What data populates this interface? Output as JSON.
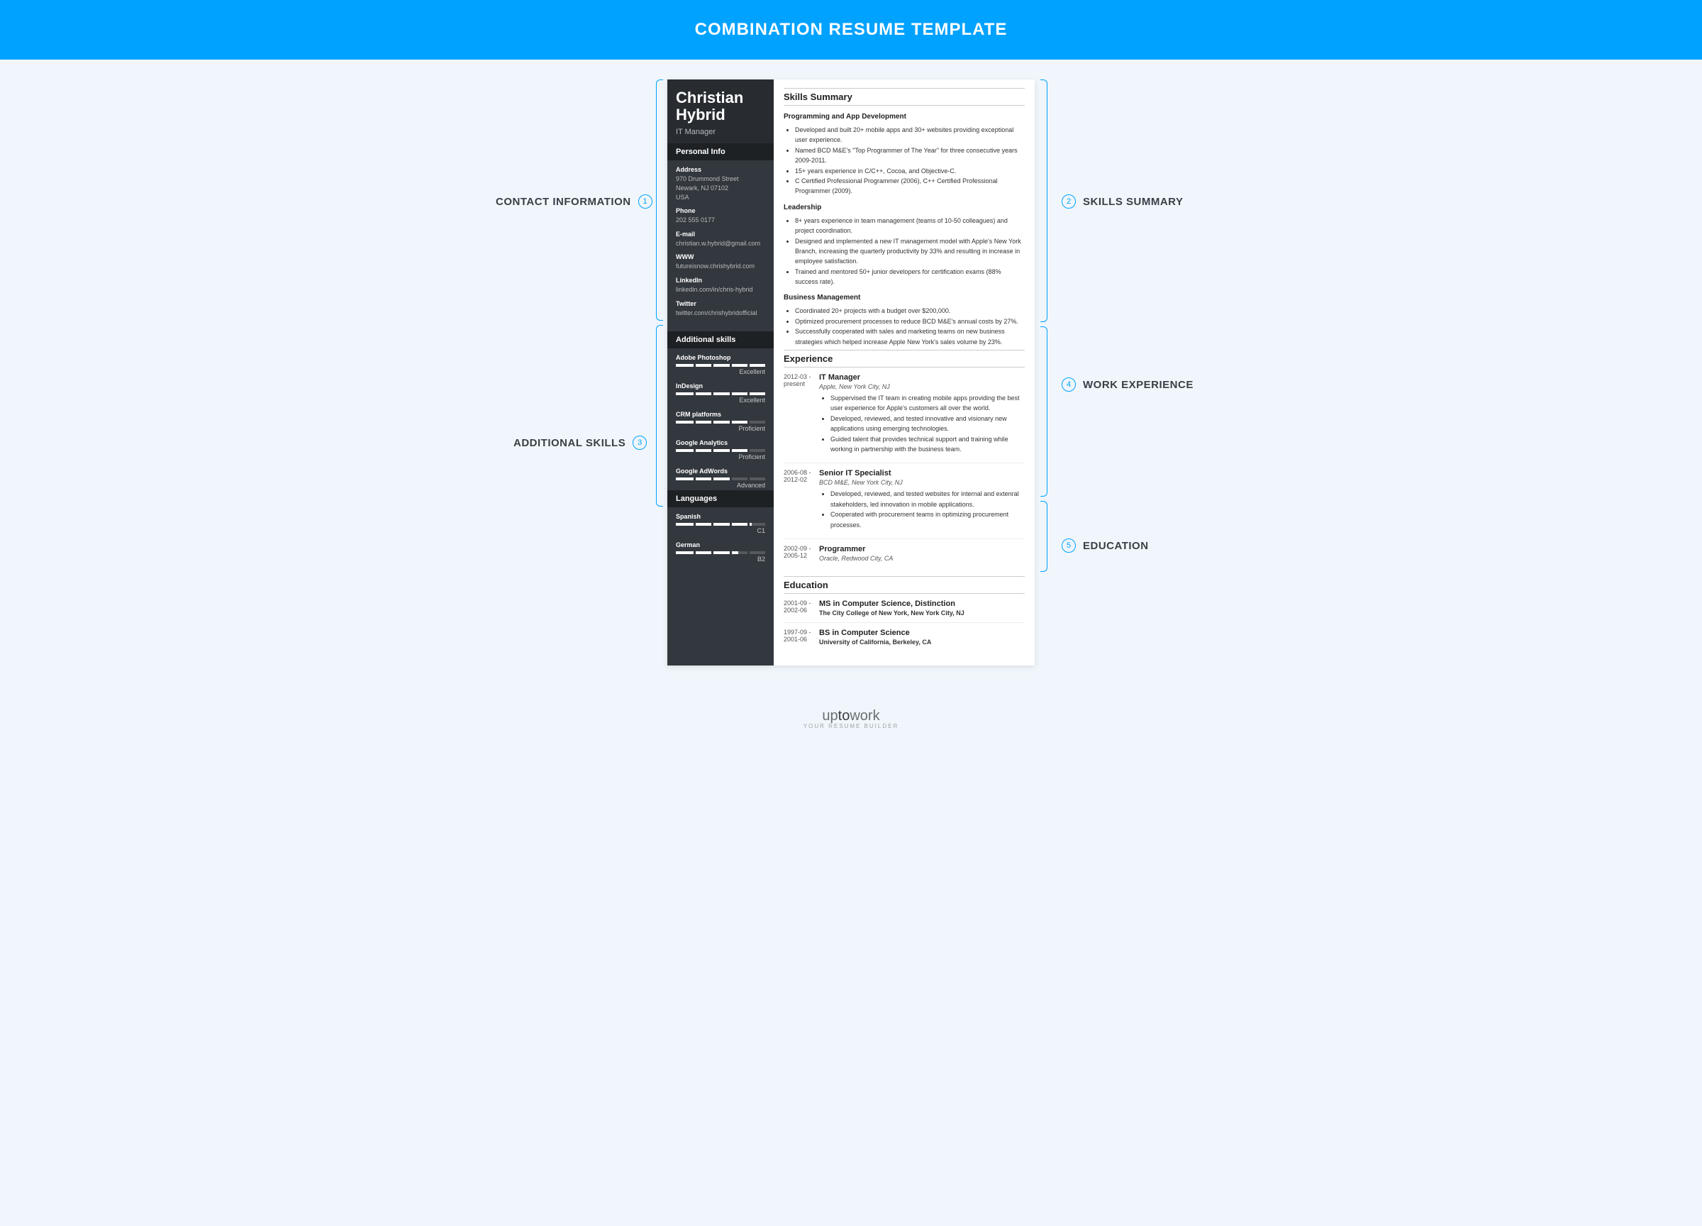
{
  "header_title": "COMBINATION RESUME TEMPLATE",
  "callouts": {
    "contact": "CONTACT INFORMATION",
    "skills_summary": "SKILLS SUMMARY",
    "additional_skills": "ADDITIONAL SKILLS",
    "work_experience": "WORK EXPERIENCE",
    "education": "EDUCATION"
  },
  "nums": {
    "n1": "1",
    "n2": "2",
    "n3": "3",
    "n4": "4",
    "n5": "5"
  },
  "name_first": "Christian",
  "name_last": "Hybrid",
  "job_title": "IT Manager",
  "sections": {
    "personal_info": "Personal Info",
    "additional_skills": "Additional skills",
    "languages": "Languages",
    "skills_summary": "Skills Summary",
    "experience": "Experience",
    "education": "Education"
  },
  "contact": {
    "address_lbl": "Address",
    "address_1": "970 Drummond Street",
    "address_2": "Newark, NJ 07102",
    "address_3": "USA",
    "phone_lbl": "Phone",
    "phone": "202 555 0177",
    "email_lbl": "E-mail",
    "email": "christian.w.hybrid@gmail.com",
    "www_lbl": "WWW",
    "www": "futureisnow.chrishybrid.com",
    "linkedin_lbl": "LinkedIn",
    "linkedin": "linkedin.com/in/chris-hybrid",
    "twitter_lbl": "Twitter",
    "twitter": "twitter.com/chrishybridofficial"
  },
  "skills": [
    {
      "name": "Adobe Photoshop",
      "level": "Excellent",
      "pct": 100
    },
    {
      "name": "InDesign",
      "level": "Excellent",
      "pct": 100
    },
    {
      "name": "CRM platforms",
      "level": "Proficient",
      "pct": 80
    },
    {
      "name": "Google Analytics",
      "level": "Proficient",
      "pct": 80
    },
    {
      "name": "Google AdWords",
      "level": "Advanced",
      "pct": 60
    }
  ],
  "languages": [
    {
      "name": "Spanish",
      "level": "C1",
      "pct": 85
    },
    {
      "name": "German",
      "level": "B2",
      "pct": 70
    }
  ],
  "summary": {
    "programming_hdr": "Programming and App Development",
    "programming": [
      "Developed and built 20+ mobile apps and 30+ websites providing exceptional user experience.",
      "Named BCD M&E's \"Top Programmer of The Year\" for three consecutive years 2009-2011.",
      "15+ years experience in C/C++, Cocoa, and Objective-C.",
      "C Certified Professional Programmer (2006), C++ Certified Professional Programmer (2009)."
    ],
    "leadership_hdr": "Leadership",
    "leadership": [
      "8+ years experience in team management (teams of 10-50 colleagues) and project coordination.",
      "Designed and implemented a new IT management model with Apple's New York Branch, increasing the quarterly productivity by 33% and resulting in increase in employee satisfaction.",
      "Trained and mentored 50+ junior developers for certification exams (88% success rate)."
    ],
    "business_hdr": "Business Management",
    "business": [
      "Coordinated 20+ projects with a budget over $200,000.",
      "Optimized procurement processes to reduce BCD M&E's annual costs by 27%.",
      "Successfully cooperated with sales and marketing teams on new business strategies which helped increase Apple New York's sales volume by 23%."
    ]
  },
  "experience": [
    {
      "dates": "2012-03 - present",
      "role": "IT Manager",
      "company": "Apple, New York City, NJ",
      "bullets": [
        "Suppervised the IT team in creating mobile apps providing the best user experience for Apple's customers all over the world.",
        "Developed, reviewed, and tested innovative and visionary new applications using emerging technologies.",
        "Guided talent that provides technical support and training while working in partnership with the business team."
      ]
    },
    {
      "dates": "2006-08 - 2012-02",
      "role": "Senior IT Specialist",
      "company": "BCD M&E, New York City, NJ",
      "bullets": [
        "Developed, reviewed, and tested websites for internal and extenral stakeholders, led innovation in mobile applications.",
        "Cooperated with procurement teams in optimizing procurement processes."
      ]
    },
    {
      "dates": "2002-09 - 2005-12",
      "role": "Programmer",
      "company": "Oracle, Redwood City, CA",
      "bullets": []
    }
  ],
  "edu": [
    {
      "dates": "2001-09 - 2002-06",
      "degree": "MS in Computer Science, Distinction",
      "school": "The City College of New York, New York City, NJ"
    },
    {
      "dates": "1997-09 - 2001-06",
      "degree": "BS in Computer Science",
      "school": "University of California, Berkeley, CA"
    }
  ],
  "footer": {
    "brand_pre": "up",
    "brand_mid": "to",
    "brand_post": "work",
    "sub": "YOUR RESUME BUILDER"
  }
}
